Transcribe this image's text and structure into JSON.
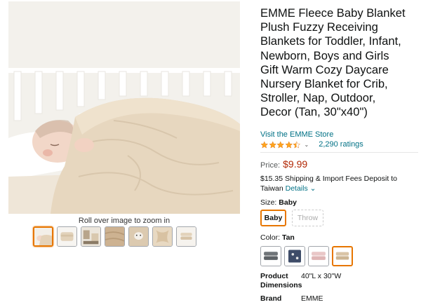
{
  "gallery": {
    "zoom_hint": "Roll over image to zoom in",
    "main_image": "sleeping-baby-under-tan-fleece-blanket",
    "thumbnails": [
      "thumb-baby-tan",
      "thumb-folded-tan",
      "thumb-nursery",
      "thumb-fleece-texture",
      "thumb-baby-closeup",
      "thumb-fleece-detail",
      "thumb-folded-stack"
    ],
    "active_thumbnail": 0
  },
  "product": {
    "title_lines": [
      "EMME Fleece Baby Blanket",
      "Plush Fuzzy Receiving",
      "Blankets for Toddler, Infant,",
      "Newborn, Boys and Girls",
      "Gift Warm Cozy Daycare",
      "Nursery Blanket for Crib,",
      "Stroller, Nap, Outdoor,",
      "Decor (Tan, 30\"x40\")"
    ],
    "store_link": "Visit the EMME Store",
    "rating_stars": 4.5,
    "rating_caret": "⌄",
    "ratings_count": "2,290 ratings",
    "price_label": "Price:",
    "price": "$9.99",
    "shipping_text": "$15.35 Shipping & Import Fees Deposit to Taiwan",
    "details_link": "Details",
    "details_caret": "⌄"
  },
  "size": {
    "label": "Size:",
    "selected": "Baby",
    "options": [
      "Baby",
      "Throw"
    ]
  },
  "color": {
    "label": "Color:",
    "selected": "Tan",
    "swatch_colors": [
      "#6f7478",
      "#3e4c68",
      "#e9c7c7",
      "#d9c4a6"
    ]
  },
  "specs": [
    {
      "key_line1": "Product",
      "key_line2": "Dimensions",
      "value": "40\"L x 30\"W"
    },
    {
      "key_line1": "Brand",
      "key_line2": "",
      "value": "EMME"
    }
  ],
  "colors": {
    "link": "#007185",
    "price": "#b12704",
    "star": "#ffa41c",
    "selected_border": "#e77600"
  }
}
